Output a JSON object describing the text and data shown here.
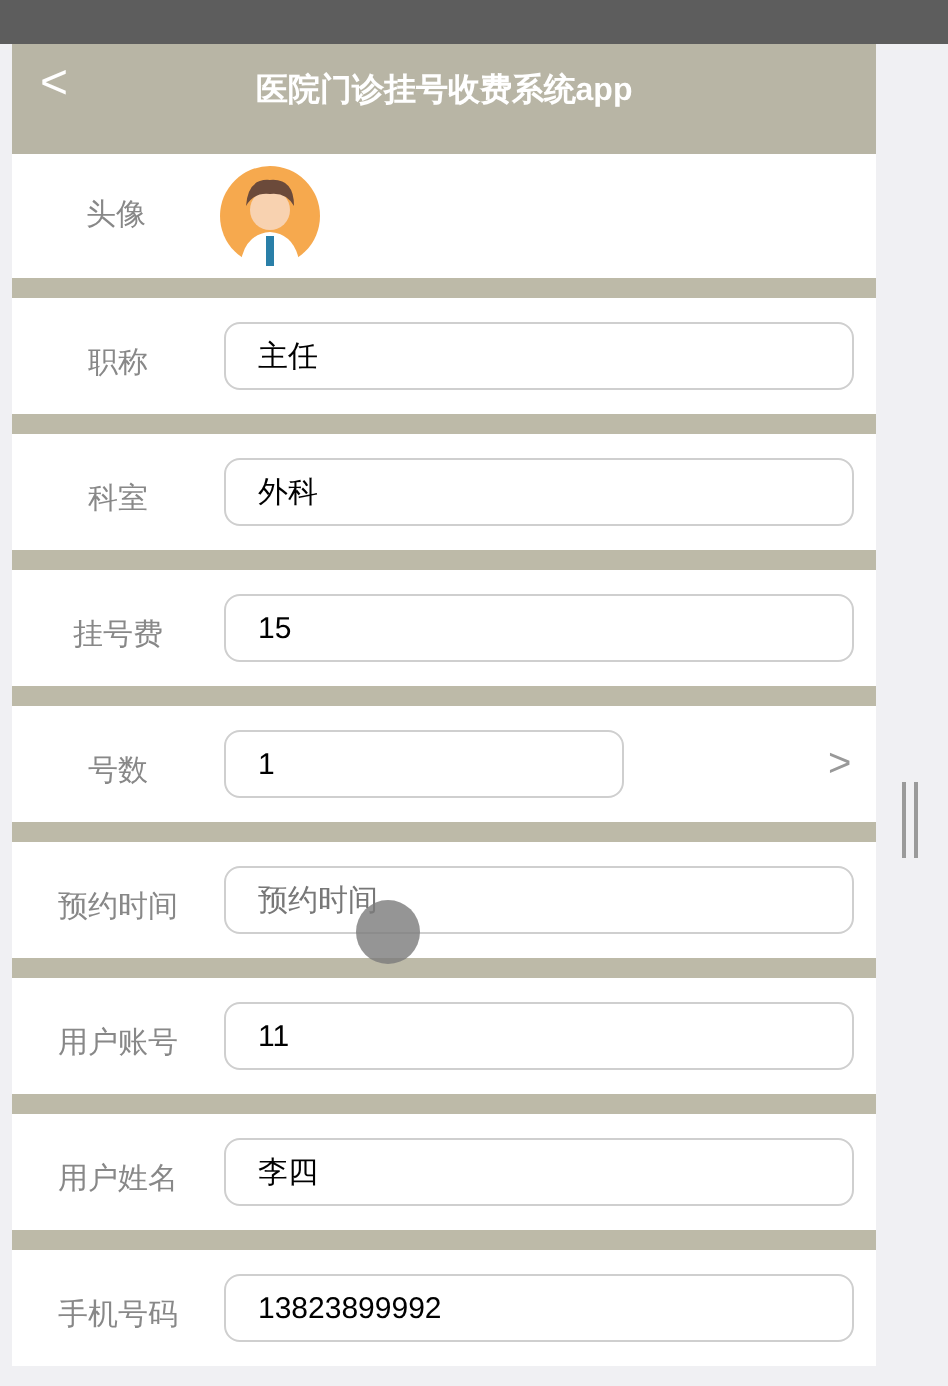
{
  "header": {
    "back": "<",
    "title": "医院门诊挂号收费系统app"
  },
  "avatar_row": {
    "label": "头像"
  },
  "fields": [
    {
      "label": "职称",
      "value": "主任",
      "kind": "text"
    },
    {
      "label": "科室",
      "value": "外科",
      "kind": "text"
    },
    {
      "label": "挂号费",
      "value": "15",
      "kind": "text"
    },
    {
      "label": "号数",
      "value": "1",
      "kind": "select",
      "chevron": ">"
    },
    {
      "label": "预约时间",
      "placeholder": "预约时间",
      "kind": "text",
      "touched": true
    },
    {
      "label": "用户账号",
      "value": "11",
      "kind": "text"
    },
    {
      "label": "用户姓名",
      "value": "李四",
      "kind": "text"
    },
    {
      "label": "手机号码",
      "value": "13823899992",
      "kind": "text"
    }
  ]
}
